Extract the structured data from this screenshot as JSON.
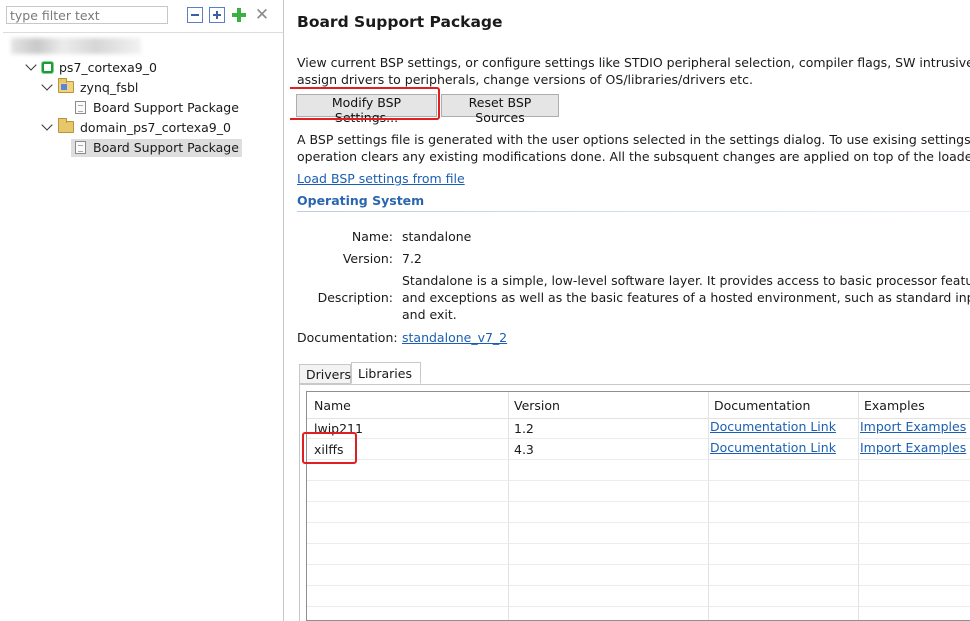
{
  "filter": {
    "placeholder": "type filter text"
  },
  "tree": {
    "nodes": [
      {
        "label": "ps7_cortexa9_0"
      },
      {
        "label": "zynq_fsbl"
      },
      {
        "label": "Board Support Package"
      },
      {
        "label": "domain_ps7_cortexa9_0"
      },
      {
        "label": "Board Support Package"
      }
    ]
  },
  "page": {
    "title": "Board Support Package",
    "intro_line1": "View current BSP settings, or configure settings like STDIO peripheral selection, compiler flags, SW intrusive profilin",
    "intro_line2": "assign drivers to peripherals, change versions of OS/libraries/drivers etc.",
    "modify_label": "Modify BSP Settings...",
    "reset_label": "Reset BSP Sources",
    "note_line1": "A BSP settings file is generated with the user options selected in the settings dialog. To use exising settings, click th",
    "note_line2": "operation clears any existing modifications done. All the subsquent changes are applied on top of the loaded settin",
    "load_link": "Load BSP settings from file"
  },
  "os": {
    "heading": "Operating System",
    "name_label": "Name:",
    "name": "standalone",
    "version_label": "Version:",
    "version": "7.2",
    "description_label": "Description:",
    "description_line1": "Standalone is a simple, low-level software layer. It provides access to basic processor features su",
    "description_line2": "and exceptions as well as the basic features of a hosted environment, such as standard input and",
    "description_line3": "and exit.",
    "documentation_label": "Documentation:",
    "documentation_link": "standalone_v7_2"
  },
  "tabs": [
    {
      "label": "Drivers",
      "active": false
    },
    {
      "label": "Libraries",
      "active": true
    }
  ],
  "libraries": {
    "columns": [
      "Name",
      "Version",
      "Documentation",
      "Examples"
    ],
    "rows": [
      {
        "name": "lwip211",
        "version": "1.2",
        "documentation": "Documentation Link",
        "examples": "Import Examples"
      },
      {
        "name": "xilffs",
        "version": "4.3",
        "documentation": "Documentation Link",
        "examples": "Import Examples"
      }
    ]
  },
  "colors": {
    "highlight": "#e02020",
    "link": "#1a5fb4",
    "section_heading": "#2a66b0"
  },
  "icons": [
    "collapse-all-icon",
    "expand-all-icon",
    "add-icon",
    "remove-icon",
    "chevron-down-icon",
    "processor-icon",
    "folder-icon",
    "bsp-document-icon"
  ]
}
